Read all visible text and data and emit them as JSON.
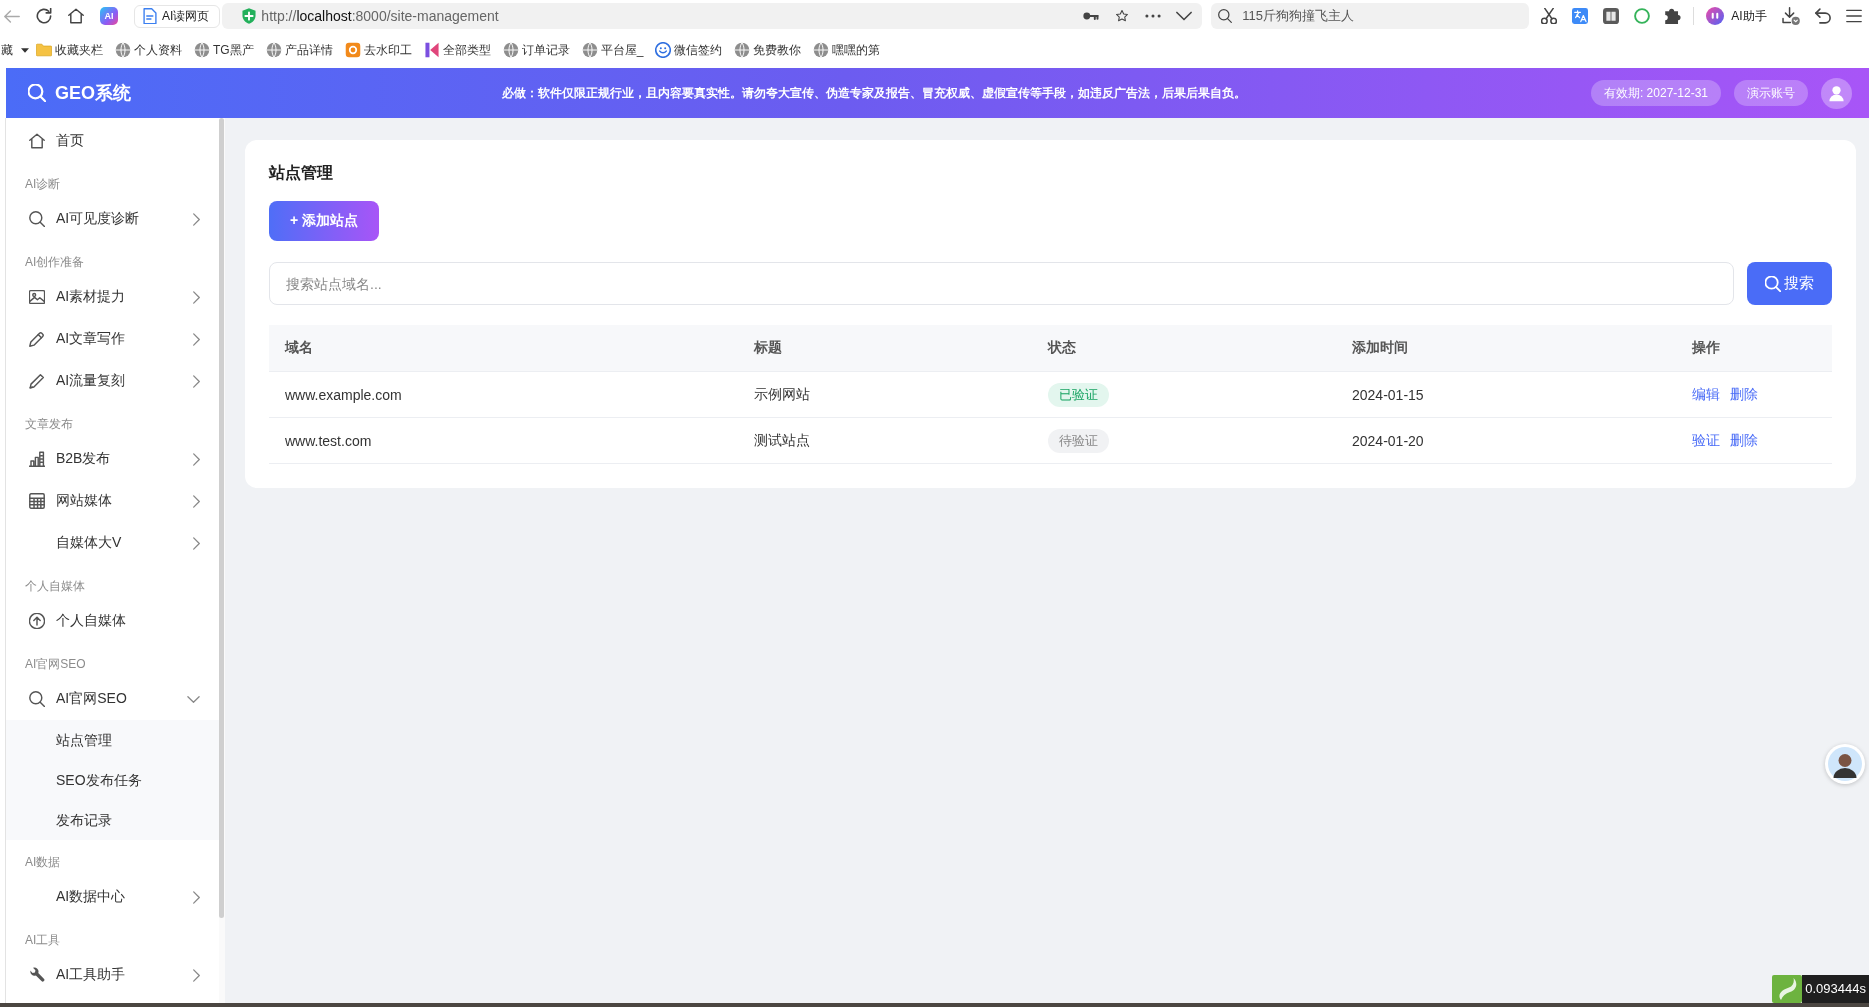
{
  "browser": {
    "logo": "AI",
    "tab": {
      "title": "AI读网页"
    },
    "url_parts": [
      {
        "text": "http://",
        "strong": false
      },
      {
        "text": "localhost",
        "strong": true
      },
      {
        "text": ":8000/site-management",
        "strong": false
      }
    ],
    "search": {
      "value": "115斤狗狗撞飞主人"
    },
    "assistant_label": "AI助手"
  },
  "bookmarks": {
    "cut_label": "藏",
    "items": [
      {
        "label": "收藏夹栏"
      },
      {
        "label": "个人资料"
      },
      {
        "label": "TG黑产"
      },
      {
        "label": "产品详情"
      },
      {
        "label": "去水印工"
      },
      {
        "label": "全部类型"
      },
      {
        "label": "订单记录"
      },
      {
        "label": "平台屋_"
      },
      {
        "label": "微信签约"
      },
      {
        "label": "免费教你"
      },
      {
        "label": "嘿嘿的第"
      }
    ]
  },
  "header": {
    "title": "GEO系统",
    "notice": "必做：软件仅限正规行业，且内容要真实性。请勿夸大宣传、伪造专家及报告、冒充权威、虚假宣传等手段，如违反广告法，后果后果自负。",
    "expiry": "有效期: 2027-12-31",
    "account": "演示账号"
  },
  "sidebar": {
    "items": [
      {
        "kind": "link",
        "label": "首页"
      },
      {
        "kind": "section",
        "label": "AI诊断"
      },
      {
        "kind": "menu",
        "label": "AI可见度诊断",
        "expanded": false
      },
      {
        "kind": "section",
        "label": "AI创作准备"
      },
      {
        "kind": "menu",
        "label": "AI素材提力",
        "expanded": false
      },
      {
        "kind": "menu",
        "label": "AI文章写作",
        "expanded": false
      },
      {
        "kind": "menu",
        "label": "AI流量复刻",
        "expanded": false
      },
      {
        "kind": "section",
        "label": "文章发布"
      },
      {
        "kind": "menu",
        "label": "B2B发布",
        "expanded": false
      },
      {
        "kind": "menu",
        "label": "网站媒体",
        "expanded": false
      },
      {
        "kind": "menu",
        "label": "自媒体大V",
        "expanded": false
      },
      {
        "kind": "section",
        "label": "个人自媒体"
      },
      {
        "kind": "link",
        "label": "个人自媒体"
      },
      {
        "kind": "section",
        "label": "AI官网SEO"
      },
      {
        "kind": "menu",
        "label": "AI官网SEO",
        "expanded": true,
        "children": [
          {
            "label": "站点管理"
          },
          {
            "label": "SEO发布任务"
          },
          {
            "label": "发布记录"
          }
        ]
      },
      {
        "kind": "section",
        "label": "AI数据"
      },
      {
        "kind": "menu",
        "label": "AI数据中心",
        "expanded": false
      },
      {
        "kind": "section",
        "label": "AI工具"
      },
      {
        "kind": "menu",
        "label": "AI工具助手",
        "expanded": false
      }
    ]
  },
  "page": {
    "title": "站点管理",
    "add_button": "+ 添加站点",
    "search": {
      "placeholder": "搜索站点域名...",
      "button": "搜索"
    }
  },
  "table": {
    "columns": [
      "域名",
      "标题",
      "状态",
      "添加时间",
      "操作"
    ],
    "rows": [
      {
        "domain": "www.example.com",
        "title": "示例网站",
        "status": {
          "label": "已验证",
          "verified": true
        },
        "added": "2024-01-15",
        "actions": [
          "编辑",
          "删除"
        ]
      },
      {
        "domain": "www.test.com",
        "title": "测试站点",
        "status": {
          "label": "待验证",
          "verified": false
        },
        "added": "2024-01-20",
        "actions": [
          "验证",
          "删除"
        ]
      }
    ]
  },
  "debug_badge": {
    "text": "0.093444s"
  }
}
